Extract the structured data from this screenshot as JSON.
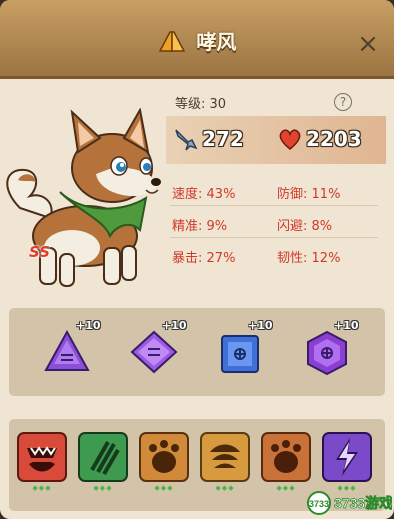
{
  "window": {
    "title": "哮风",
    "close_icon": "×"
  },
  "pet": {
    "grade": "SS",
    "level_label": "等级: 30",
    "help_icon": "?"
  },
  "power": {
    "attack": "272",
    "hp": "2203"
  },
  "attributes": [
    {
      "label": "速度:",
      "value": "43%"
    },
    {
      "label": "防御:",
      "value": "11%"
    },
    {
      "label": "精准:",
      "value": "9%"
    },
    {
      "label": "闪避:",
      "value": "8%"
    },
    {
      "label": "暴击:",
      "value": "27%"
    },
    {
      "label": "韧性:",
      "value": "12%"
    }
  ],
  "gems": [
    {
      "name": "purple-triangle-gem",
      "bonus": "+10",
      "color": "#8b4fd8"
    },
    {
      "name": "purple-diamond-gem",
      "bonus": "+10",
      "color": "#9b5be0"
    },
    {
      "name": "blue-square-gem",
      "bonus": "+10",
      "color": "#3f6fd8"
    },
    {
      "name": "purple-hexagon-gem",
      "bonus": "+10",
      "color": "#8a3fd0"
    }
  ],
  "skills": [
    {
      "name": "bite-skill-icon",
      "color": "#d84a3a"
    },
    {
      "name": "claw-skill-icon",
      "color": "#3e9a4e"
    },
    {
      "name": "paw-skill-icon",
      "color": "#d08a3a"
    },
    {
      "name": "shell-skill-icon",
      "color": "#d89a3e"
    },
    {
      "name": "paw-skill-icon-2",
      "color": "#c8723a"
    },
    {
      "name": "lightning-skill-icon",
      "color": "#7a4ac8"
    }
  ],
  "watermark": {
    "text": "3733游戏"
  }
}
